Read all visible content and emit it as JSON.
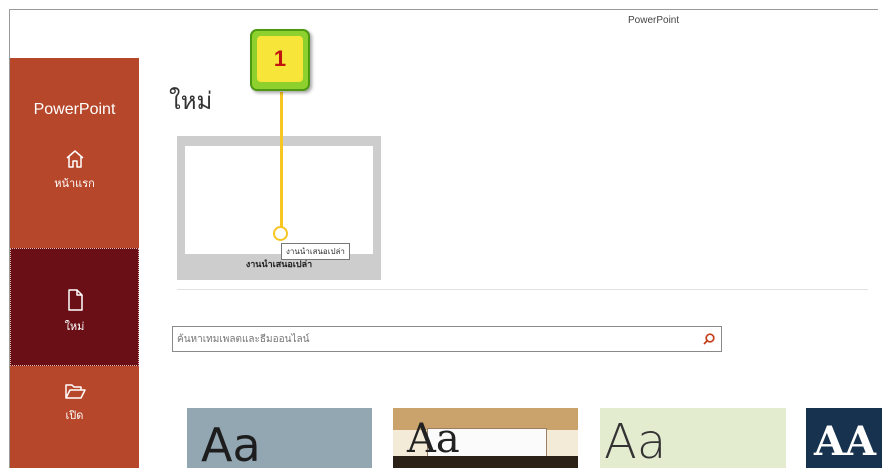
{
  "window": {
    "title": "PowerPoint"
  },
  "sidebar": {
    "app_name": "PowerPoint",
    "items": [
      {
        "label": "หน้าแรก",
        "icon": "home-icon"
      },
      {
        "label": "ใหม่",
        "icon": "new-document-icon",
        "selected": true
      },
      {
        "label": "เปิด",
        "icon": "open-folder-icon"
      }
    ]
  },
  "main": {
    "heading": "ใหม่",
    "blank_template": {
      "label": "งานนำเสนอเปล่า",
      "tooltip": "งานนำเสนอเปล่า"
    },
    "search": {
      "placeholder": "ค้นหาเทมเพลตและธีมออนไลน์",
      "icon": "search-icon"
    },
    "themes": [
      {
        "sample": "Aa"
      },
      {
        "sample": "Aa"
      },
      {
        "sample": "Aa"
      },
      {
        "sample": "AA"
      }
    ]
  },
  "annotation": {
    "number": "1"
  },
  "colors": {
    "sidebar_bg": "#b7472a",
    "sidebar_selected_bg": "#6b0f16",
    "badge_outer": "#8ed12e",
    "badge_inner": "#f8e53a",
    "badge_text": "#c0140f",
    "leader": "#f7c623"
  }
}
